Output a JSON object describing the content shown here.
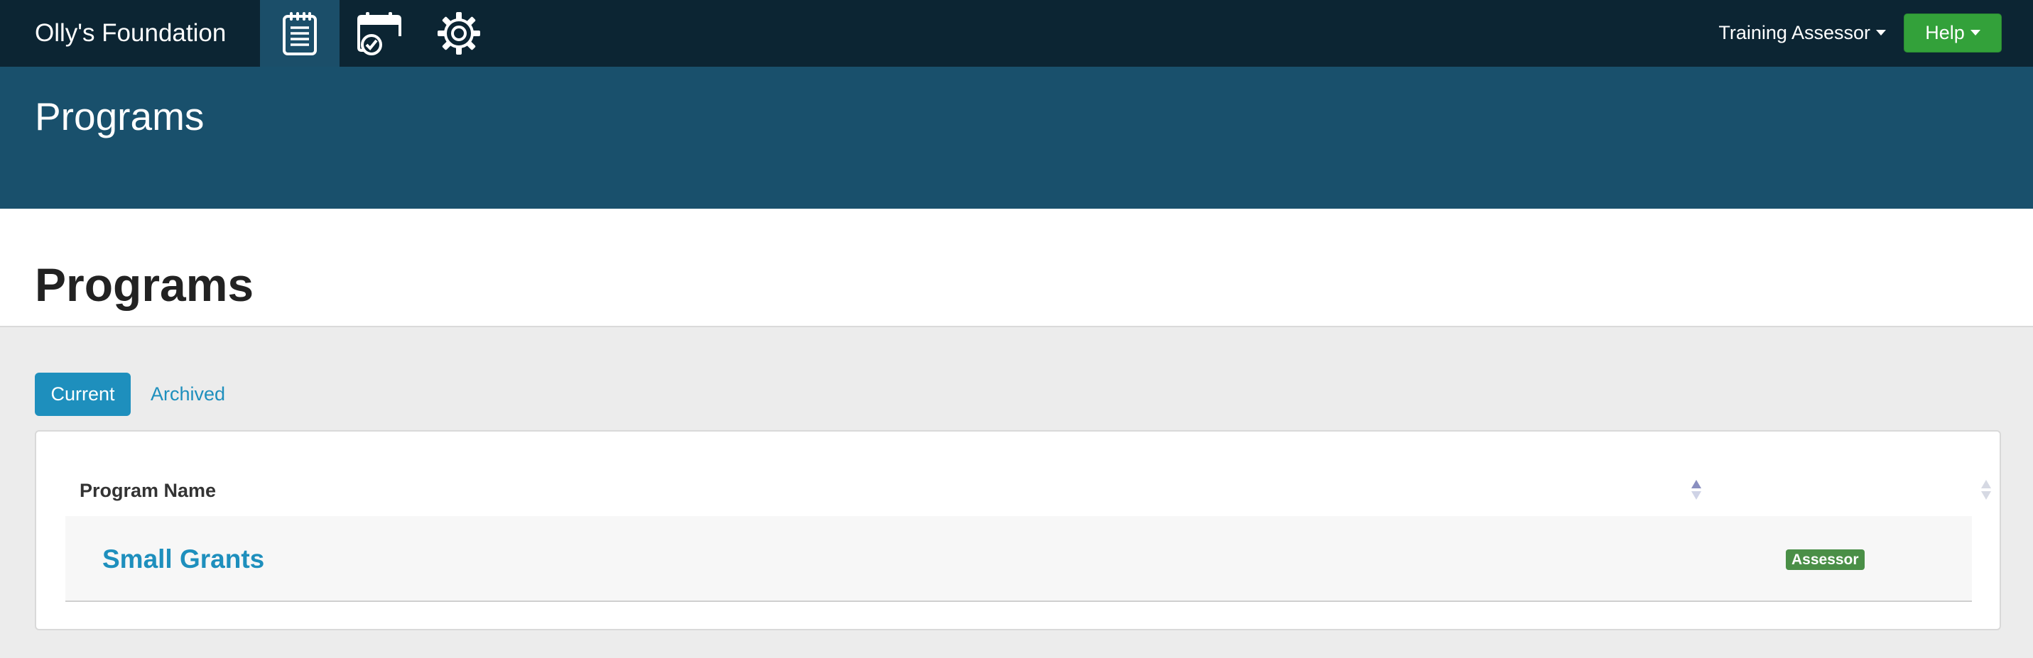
{
  "navbar": {
    "brand": "Olly's Foundation",
    "icons": [
      {
        "name": "clipboard-icon",
        "active": true
      },
      {
        "name": "calendar-check-icon",
        "active": false
      },
      {
        "name": "gear-icon",
        "active": false
      }
    ],
    "user_menu_label": "Training Assessor",
    "help_label": "Help"
  },
  "header_band": {
    "title": "Programs"
  },
  "page": {
    "title": "Programs"
  },
  "tabs": [
    {
      "label": "Current",
      "active": true
    },
    {
      "label": "Archived",
      "active": false
    }
  ],
  "table": {
    "columns": [
      "Program Name",
      ""
    ],
    "rows": [
      {
        "name": "Small Grants",
        "role": "Assessor"
      }
    ]
  },
  "colors": {
    "navbar_bg": "#0c2533",
    "band_bg": "#19506c",
    "accent": "#1e8fbd",
    "help_green": "#33a13a",
    "badge_green": "#4a8f47"
  }
}
